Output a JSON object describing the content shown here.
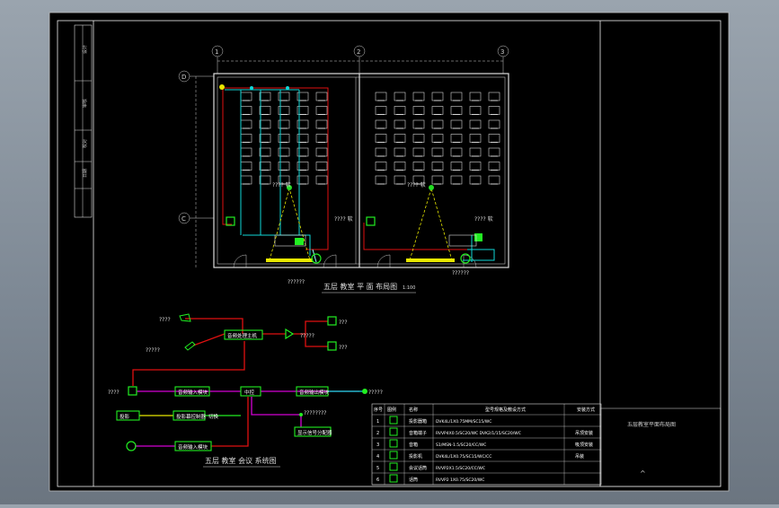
{
  "drawing": {
    "plan_title": "五层 教室 平 面 布局图",
    "plan_scale": "1:100",
    "system_title": "五层 教室 会议 系统图",
    "titleblock_name": "五层教室平面布局图",
    "titleblock_mark": "^",
    "grid_labels": [
      "1",
      "2",
      "3",
      "D",
      "C"
    ],
    "side_labels": [
      "设计",
      "审核",
      "校对",
      "日期"
    ]
  },
  "plan_tags": {
    "left_mic": "???? 软",
    "left_mic_b": "???? 软",
    "right_mic": "???? 软",
    "right_mic_b": "???? 软",
    "left_bottom": "??????",
    "right_bottom": "??????"
  },
  "system": {
    "mic1": "????",
    "mic2": "?????",
    "ext_in": "????",
    "out_right": "?????",
    "branch": "????????",
    "spk_label": "???",
    "spk_label2": "???",
    "amp_out": "?????",
    "blocks": {
      "mixer": "音频处理主机",
      "matrix": "中控",
      "in1": "音频输入模块",
      "in2": "音频输入模块",
      "out1": "音频输出模块",
      "projector": "投影",
      "screen_ctrl": "投影幕控制器",
      "local_sw": "切换",
      "vga_box": "显示信号分配器"
    }
  },
  "legend": {
    "headers": [
      "序号",
      "图例",
      "名称",
      "型号规格及敷设方式",
      "安装方式"
    ],
    "rows": [
      {
        "no": "1",
        "name": "投影器箱",
        "spec": "DVK4L/1X0.75MM/SC15/WC",
        "mount": ""
      },
      {
        "no": "2",
        "name": "音箱端子",
        "spec": "RVVP4X0.5/SC20/WC  DVK2/1/15/SC20/WC",
        "mount": "吊顶安装"
      },
      {
        "no": "3",
        "name": "音箱",
        "spec": "S1/MSN-1.5/SC20/CC/WC",
        "mount": "吸顶安装"
      },
      {
        "no": "4",
        "name": "投影机",
        "spec": "DVK4L/1X0.75/SC15/WC/CC",
        "mount": "吊装"
      },
      {
        "no": "5",
        "name": "会议话筒",
        "spec": "RVVP2X1.5/SC20/CC/WC",
        "mount": ""
      },
      {
        "no": "6",
        "name": "话筒",
        "spec": "RVVP2 1X0.75/SC20/WC",
        "mount": ""
      }
    ]
  }
}
